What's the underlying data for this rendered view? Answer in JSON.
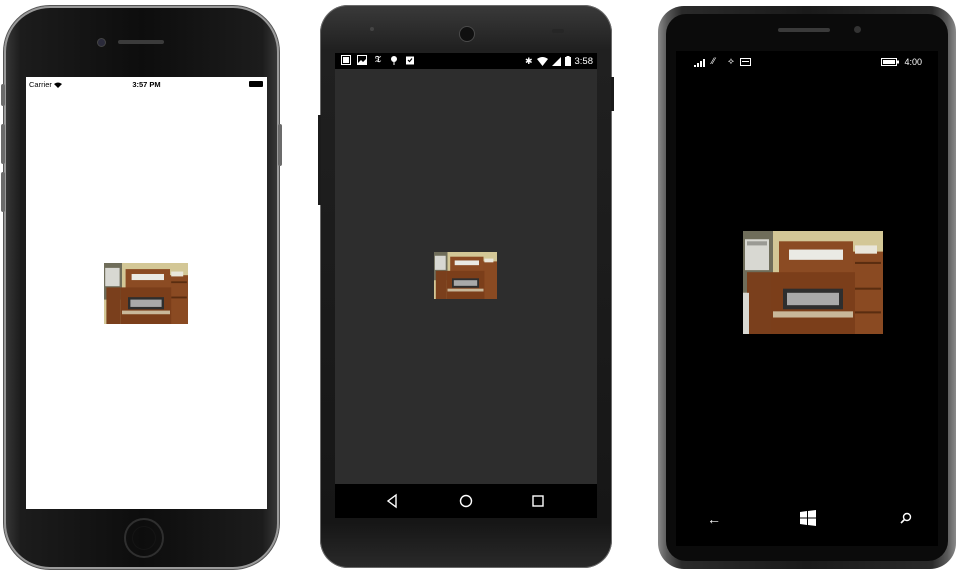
{
  "ios": {
    "carrier": "Carrier",
    "time": "3:57 PM",
    "screen_bg": "#ffffff",
    "icons": [
      "wifi-icon",
      "battery-icon"
    ]
  },
  "android": {
    "time": "3:58",
    "screen_bg": "#2d2d2d",
    "notification_icons": [
      "image-icon",
      "photo-icon",
      "nytimes-icon",
      "pin-icon",
      "clipboard-icon"
    ],
    "status_icons": [
      "bluetooth-icon",
      "wifi-icon",
      "signal-icon",
      "battery-icon"
    ],
    "nav": [
      "back-icon",
      "home-icon",
      "recents-icon"
    ]
  },
  "winphone": {
    "time": "4:00",
    "screen_bg": "#000000",
    "status_icons": [
      "signal-icon",
      "wifi-icon",
      "data-icon",
      "message-icon",
      "battery-icon"
    ],
    "nav": [
      "back-icon",
      "windows-icon",
      "search-icon"
    ]
  },
  "image_subject": "typewriter-photo"
}
